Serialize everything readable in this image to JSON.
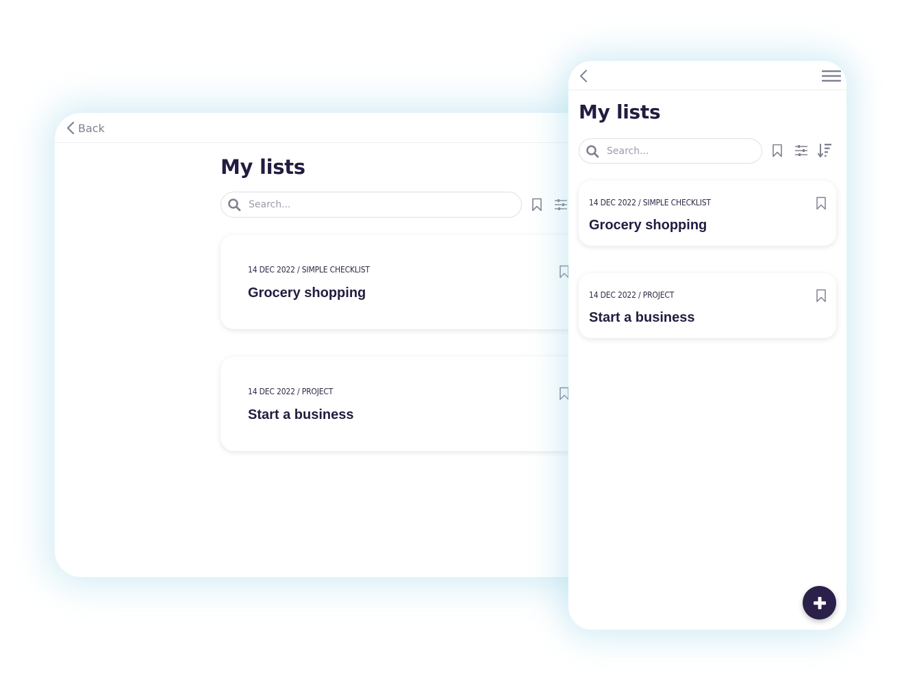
{
  "desktop": {
    "back_label": "Back",
    "title": "My lists",
    "search": {
      "placeholder": "Search...",
      "value": ""
    },
    "toolbar_icons": [
      "bookmark-icon",
      "filter-sliders-icon"
    ],
    "lists": [
      {
        "meta": "14 DEC 2022 / SIMPLE CHECKLIST",
        "title": "Grocery shopping",
        "bookmarked": false
      },
      {
        "meta": "14 DEC 2022 / PROJECT",
        "title": "Start a business",
        "bookmarked": false
      }
    ]
  },
  "mobile": {
    "title": "My lists",
    "search": {
      "placeholder": "Search...",
      "value": ""
    },
    "toolbar_icons": [
      "bookmark-icon",
      "filter-sliders-icon",
      "sort-descending-icon"
    ],
    "nav_icons": [
      "chevron-left-icon",
      "hamburger-menu-icon"
    ],
    "lists": [
      {
        "meta": "14 DEC 2022 / SIMPLE CHECKLIST",
        "title": "Grocery shopping",
        "bookmarked": false
      },
      {
        "meta": "14 DEC 2022 / PROJECT",
        "title": "Start a business",
        "bookmarked": false
      }
    ],
    "fab_icon": "plus-icon"
  },
  "colors": {
    "primary_dark": "#231c40",
    "fab": "#2b2049",
    "icon_gray": "#7e8090",
    "shadow_glow": "#a0d7eb"
  }
}
